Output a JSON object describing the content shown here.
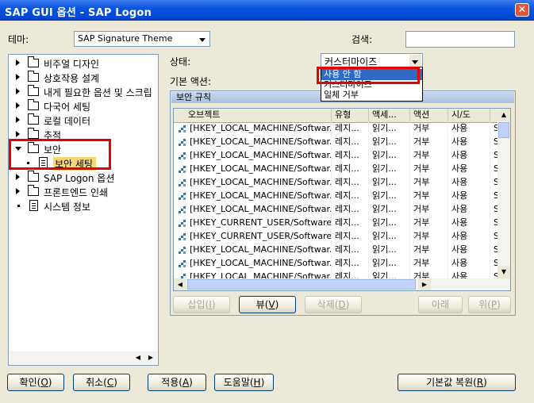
{
  "window": {
    "title": "SAP GUI 옵션 - SAP Logon",
    "close_label": "✕"
  },
  "theme": {
    "label": "테마:",
    "value": "SAP Signature Theme"
  },
  "search": {
    "label": "검색:",
    "value": ""
  },
  "tree": {
    "items": [
      {
        "label": "비주얼 디자인",
        "type": "folder",
        "state": "collapsed"
      },
      {
        "label": "상호작용 설계",
        "type": "folder",
        "state": "collapsed"
      },
      {
        "label": "내게 필요한 옵션 및 스크립",
        "type": "folder",
        "state": "collapsed"
      },
      {
        "label": "다국어 세팅",
        "type": "folder",
        "state": "collapsed"
      },
      {
        "label": "로컬 데이터",
        "type": "folder",
        "state": "collapsed"
      },
      {
        "label": "추적",
        "type": "folder",
        "state": "collapsed"
      },
      {
        "label": "보안",
        "type": "folder",
        "state": "expanded"
      },
      {
        "label": "보안 세팅",
        "type": "doc",
        "state": "selected"
      },
      {
        "label": "SAP Logon 옵션",
        "type": "folder",
        "state": "collapsed"
      },
      {
        "label": "프론트엔드 인쇄",
        "type": "folder",
        "state": "collapsed"
      },
      {
        "label": "시스템 정보",
        "type": "doc",
        "state": "leaf"
      }
    ]
  },
  "status": {
    "label": "상태:",
    "value": "커스터마이즈",
    "options": [
      "사용 안 함",
      "커스터마이즈",
      "일체 거부"
    ]
  },
  "default_action": {
    "label": "기본 액션:"
  },
  "rules": {
    "title": "보안 규칙",
    "columns": [
      "오브젝트",
      "유형",
      "액세...",
      "액션",
      "시/도",
      ""
    ],
    "rows": [
      [
        "[HKEY_LOCAL_MACHINE/Softwar...",
        "레지...",
        "읽기...",
        "거부",
        "사용",
        "S"
      ],
      [
        "[HKEY_LOCAL_MACHINE/Softwar...",
        "레지...",
        "읽기...",
        "거부",
        "사용",
        "S"
      ],
      [
        "[HKEY_LOCAL_MACHINE/Softwar...",
        "레지...",
        "읽기...",
        "거부",
        "사용",
        "S"
      ],
      [
        "[HKEY_LOCAL_MACHINE/Softwar...",
        "레지...",
        "읽기...",
        "거부",
        "사용",
        "S"
      ],
      [
        "[HKEY_LOCAL_MACHINE/Softwar...",
        "레지...",
        "읽기...",
        "거부",
        "사용",
        "S"
      ],
      [
        "[HKEY_LOCAL_MACHINE/Softwar...",
        "레지...",
        "읽기...",
        "거부",
        "사용",
        "S"
      ],
      [
        "[HKEY_LOCAL_MACHINE/Softwar...",
        "레지...",
        "읽기...",
        "거부",
        "사용",
        "S"
      ],
      [
        "[HKEY_CURRENT_USER/Software...",
        "레지...",
        "읽기...",
        "거부",
        "사용",
        "S"
      ],
      [
        "[HKEY_CURRENT_USER/Software...",
        "레지...",
        "읽기...",
        "거부",
        "사용",
        "S"
      ],
      [
        "[HKEY_LOCAL_MACHINE/Softwar...",
        "레지...",
        "읽기...",
        "거부",
        "사용",
        "S"
      ],
      [
        "[HKEY_LOCAL_MACHINE/Softwar...",
        "레지...",
        "읽기...",
        "거부",
        "사용",
        "S"
      ],
      [
        "[HKEY_LOCAL_MACHINE/Softwar...",
        "레지...",
        "읽기...",
        "거부",
        "사용",
        "S"
      ]
    ]
  },
  "rule_buttons": {
    "insert": {
      "label": "삽입",
      "key": "I"
    },
    "view": {
      "label": "뷰",
      "key": "V"
    },
    "delete": {
      "label": "삭제",
      "key": "D"
    },
    "down": {
      "label": "아래"
    },
    "up": {
      "label": "위",
      "key": "P"
    }
  },
  "footer": {
    "ok": {
      "label": "확인",
      "key": "O"
    },
    "cancel": {
      "label": "취소",
      "key": "C"
    },
    "apply": {
      "label": "적용",
      "key": "A"
    },
    "help": {
      "label": "도움말",
      "key": "H"
    },
    "reset": {
      "label": "기본값 복원",
      "key": "R"
    }
  },
  "colors": {
    "highlight": "#316ac5",
    "annotation": "#e60000",
    "selected_item": "#f7d674"
  }
}
